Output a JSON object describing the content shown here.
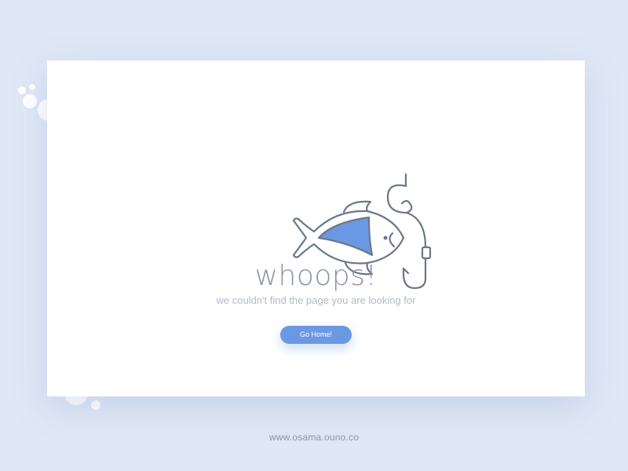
{
  "page": {
    "background": "#e0e8f6"
  },
  "error": {
    "title": "whoops!",
    "message": "we couldn't find the page you are looking for",
    "illustration_icon": "fish-hook-icon"
  },
  "actions": {
    "home_label": "Go Home!",
    "accent": "#6b98e2"
  },
  "footer": {
    "url": "www.osama.ouno.co"
  },
  "colors": {
    "line": "#6c768a",
    "fish_fill": "#6b98e2",
    "title": "#8c93a6",
    "subtitle": "#b3b9c8"
  }
}
